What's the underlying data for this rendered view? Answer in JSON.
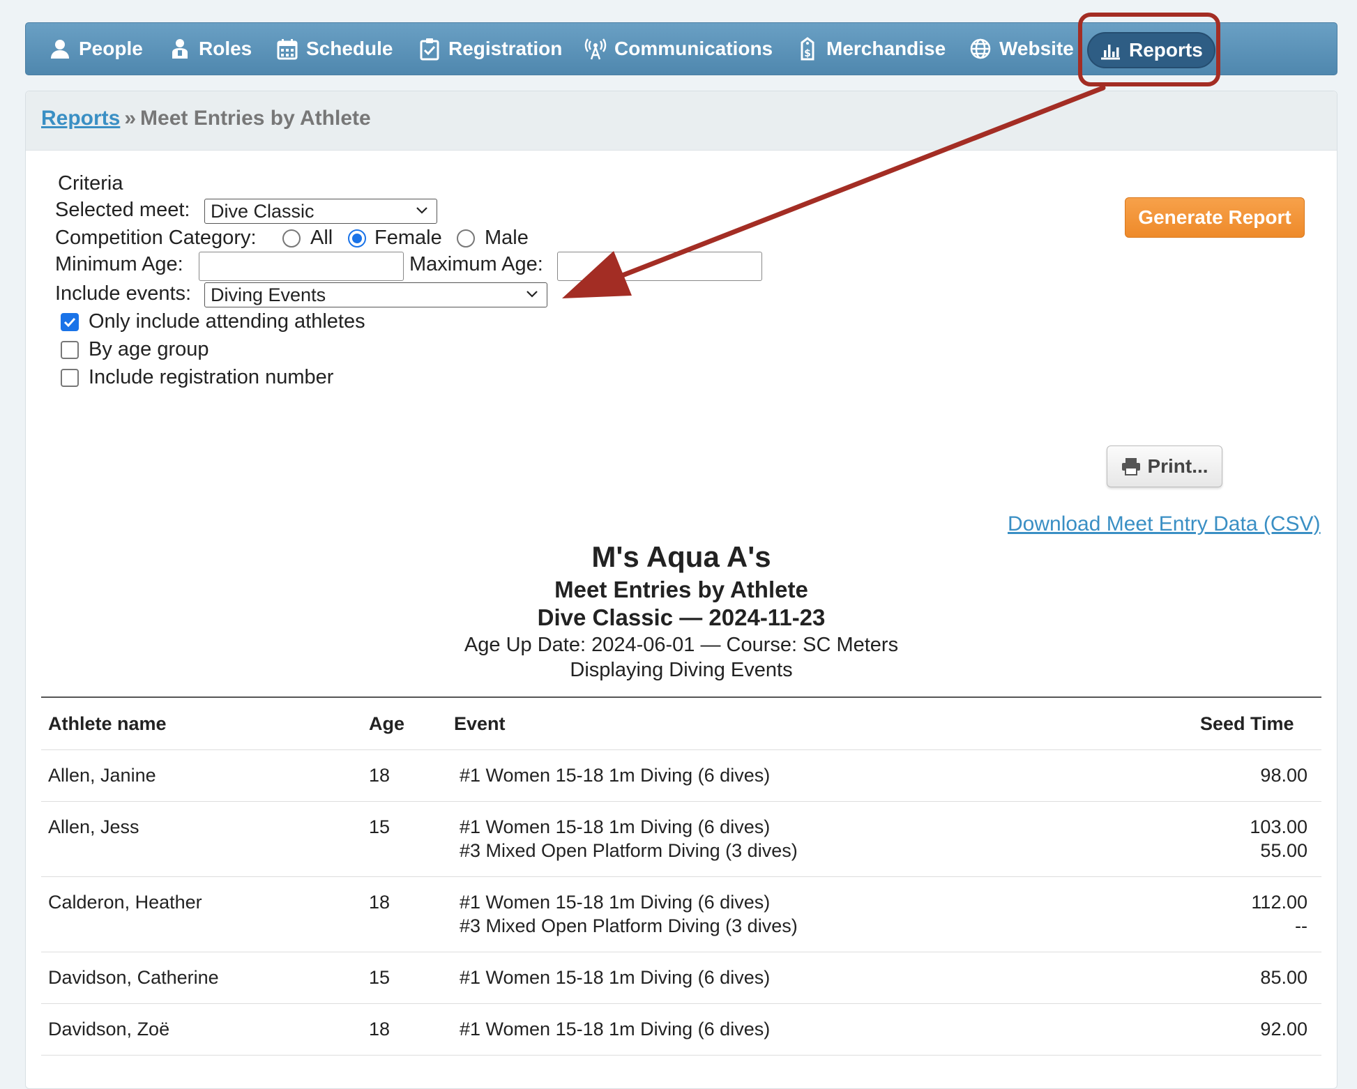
{
  "nav": {
    "items": [
      {
        "name": "people",
        "label": "People",
        "icon": "person-icon"
      },
      {
        "name": "roles",
        "label": "Roles",
        "icon": "user-badge-icon"
      },
      {
        "name": "schedule",
        "label": "Schedule",
        "icon": "calendar-icon"
      },
      {
        "name": "registration",
        "label": "Registration",
        "icon": "clipboard-check-icon"
      },
      {
        "name": "communications",
        "label": "Communications",
        "icon": "broadcast-icon"
      },
      {
        "name": "merchandise",
        "label": "Merchandise",
        "icon": "price-tag-icon"
      },
      {
        "name": "website",
        "label": "Website",
        "icon": "globe-icon"
      },
      {
        "name": "reports",
        "label": "Reports",
        "icon": "bar-chart-icon",
        "active": true
      }
    ]
  },
  "breadcrumb": {
    "link": "Reports",
    "separator": "»",
    "current": "Meet Entries by Athlete"
  },
  "criteria": {
    "heading": "Criteria",
    "selected_meet_label": "Selected meet:",
    "selected_meet_value": "Dive Classic",
    "category_label": "Competition Category:",
    "category_options": [
      "All",
      "Female",
      "Male"
    ],
    "category_selected": "Female",
    "min_age_label": "Minimum Age:",
    "min_age_value": "",
    "max_age_label": "Maximum Age:",
    "max_age_value": "",
    "include_events_label": "Include events:",
    "include_events_value": "Diving Events",
    "checkboxes": [
      {
        "label": "Only include attending athletes",
        "checked": true
      },
      {
        "label": "By age group",
        "checked": false
      },
      {
        "label": "Include registration number",
        "checked": false
      }
    ]
  },
  "actions": {
    "generate": "Generate Report",
    "print": "Print...",
    "download_csv": "Download Meet Entry Data (CSV)"
  },
  "report": {
    "team": "M's Aqua A's",
    "title": "Meet Entries by Athlete",
    "meet_line": "Dive Classic — 2024-11-23",
    "info_line": "Age Up Date: 2024-06-01 — Course: SC Meters",
    "display_line": "Displaying Diving Events",
    "columns": {
      "athlete": "Athlete name",
      "age": "Age",
      "event": "Event",
      "seed": "Seed Time"
    },
    "rows": [
      {
        "athlete": "Allen, Janine",
        "age": "18",
        "events": [
          "#1 Women 15-18 1m Diving (6 dives)"
        ],
        "seeds": [
          "98.00"
        ]
      },
      {
        "athlete": "Allen, Jess",
        "age": "15",
        "events": [
          "#1 Women 15-18 1m Diving (6 dives)",
          "#3 Mixed Open Platform Diving (3 dives)"
        ],
        "seeds": [
          "103.00",
          "55.00"
        ]
      },
      {
        "athlete": "Calderon, Heather",
        "age": "18",
        "events": [
          "#1 Women 15-18 1m Diving (6 dives)",
          "#3 Mixed Open Platform Diving (3 dives)"
        ],
        "seeds": [
          "112.00",
          "--"
        ]
      },
      {
        "athlete": "Davidson, Catherine",
        "age": "15",
        "events": [
          "#1 Women 15-18 1m Diving (6 dives)"
        ],
        "seeds": [
          "85.00"
        ]
      },
      {
        "athlete": "Davidson, Zoë",
        "age": "18",
        "events": [
          "#1 Women 15-18 1m Diving (6 dives)"
        ],
        "seeds": [
          "92.00"
        ]
      }
    ]
  },
  "colors": {
    "nav": "#5a92b8",
    "active_nav": "#2e5d84",
    "annotation": "#a32d24",
    "generate": "#f0902f",
    "link": "#3a8fc4",
    "checkbox": "#1a73e8"
  }
}
